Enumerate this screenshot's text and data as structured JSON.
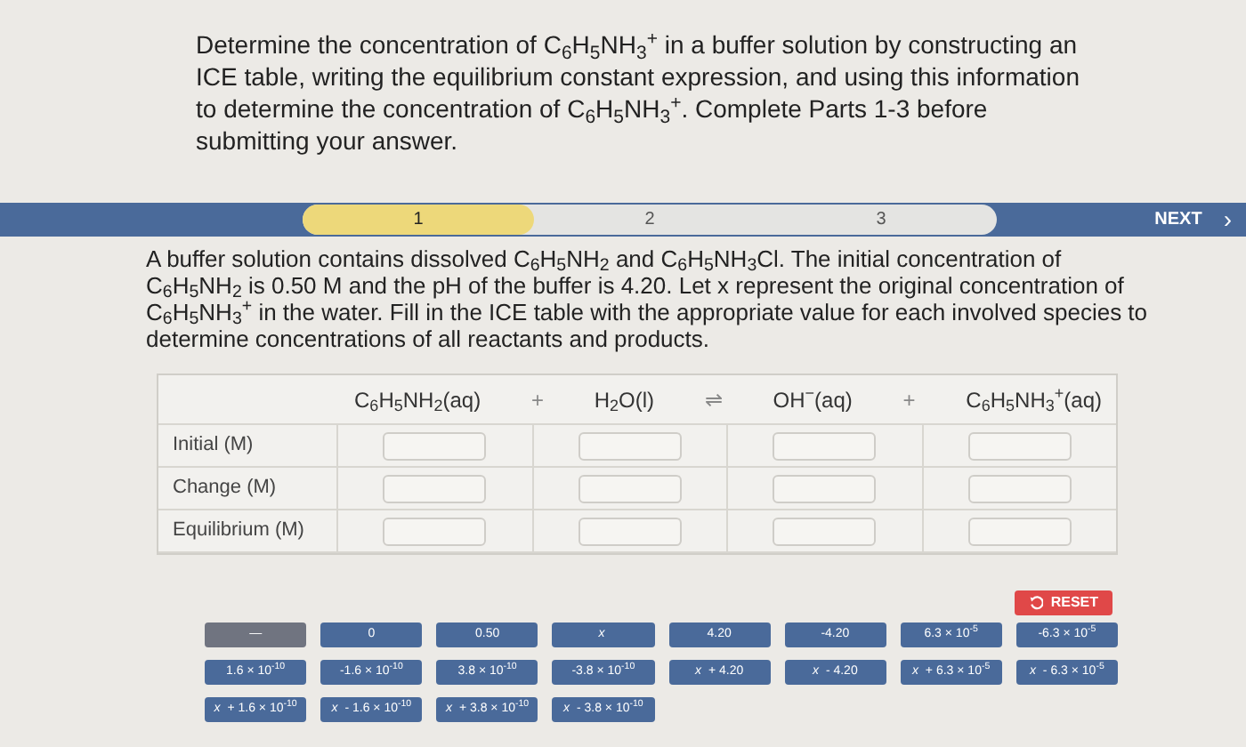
{
  "question": "Determine the concentration of C$_{6}$H$_{5}$NH$_{3}$$^{+}$ in a buffer solution by constructing an ICE table, writing the equilibrium constant expression, and using this information to determine the concentration of C$_{6}$H$_{5}$NH$_{3}$$^{+}$. Complete Parts 1-3 before submitting your answer.",
  "steps": [
    {
      "label": "1",
      "selected": true
    },
    {
      "label": "2",
      "selected": false
    },
    {
      "label": "3",
      "selected": false
    }
  ],
  "next_button": {
    "label": "NEXT",
    "icon": "›"
  },
  "problem": "A buffer solution contains dissolved C$_{6}$H$_{5}$NH$_{2}$ and C$_{6}$H$_{5}$NH$_{3}$Cl. The initial concentration of C$_{6}$H$_{5}$NH$_{2}$ is 0.50 M and the pH of the buffer is 4.20. Let x represent the original concentration of C$_{6}$H$_{5}$NH$_{3}$$^{+}$ in the water. Fill in the ICE table with the appropriate value for each involved species to determine concentrations of all reactants and products.",
  "ice_table": {
    "header": [
      {
        "kind": "species",
        "text": "C$_{6}$H$_{5}$NH$_{2}$(aq)"
      },
      {
        "kind": "operator",
        "text": "+"
      },
      {
        "kind": "species",
        "text": "H$_{2}$O(l)"
      },
      {
        "kind": "operator",
        "text": "⇌"
      },
      {
        "kind": "species",
        "text": "OH$^{−}$(aq)"
      },
      {
        "kind": "operator",
        "text": "+"
      },
      {
        "kind": "species",
        "text": "C$_{6}$H$_{5}$NH$_{3}$$^{+}$(aq)"
      }
    ],
    "rows": [
      "Initial (M)",
      "Change (M)",
      "Equilibrium (M)"
    ]
  },
  "reset_button": {
    "label": "RESET"
  },
  "tiles": [
    {
      "text": "—",
      "disabled": true
    },
    {
      "text": "0",
      "disabled": false
    },
    {
      "text": "0.50",
      "disabled": false
    },
    {
      "text": "*x*",
      "disabled": false
    },
    {
      "text": "4.20",
      "disabled": false
    },
    {
      "text": "-4.20",
      "disabled": false
    },
    {
      "text": "6.3 × 10$^{-5}$",
      "disabled": false
    },
    {
      "text": "-6.3 × 10$^{-5}$",
      "disabled": false
    },
    {
      "text": "1.6 × 10$^{-10}$",
      "disabled": false
    },
    {
      "text": "-1.6 × 10$^{-10}$",
      "disabled": false
    },
    {
      "text": "3.8 × 10$^{-10}$",
      "disabled": false
    },
    {
      "text": "-3.8 × 10$^{-10}$",
      "disabled": false
    },
    {
      "text": "*x* + 4.20",
      "disabled": false
    },
    {
      "text": "*x* - 4.20",
      "disabled": false
    },
    {
      "text": "*x* + 6.3 × 10$^{-5}$",
      "disabled": false
    },
    {
      "text": "*x* - 6.3 × 10$^{-5}$",
      "disabled": false
    },
    {
      "text": "*x* + 1.6 × 10$^{-10}$",
      "disabled": false
    },
    {
      "text": "*x* - 1.6 × 10$^{-10}$",
      "disabled": false
    },
    {
      "text": "*x* + 3.8 × 10$^{-10}$",
      "disabled": false
    },
    {
      "text": "*x* - 3.8 × 10$^{-10}$",
      "disabled": false
    }
  ]
}
